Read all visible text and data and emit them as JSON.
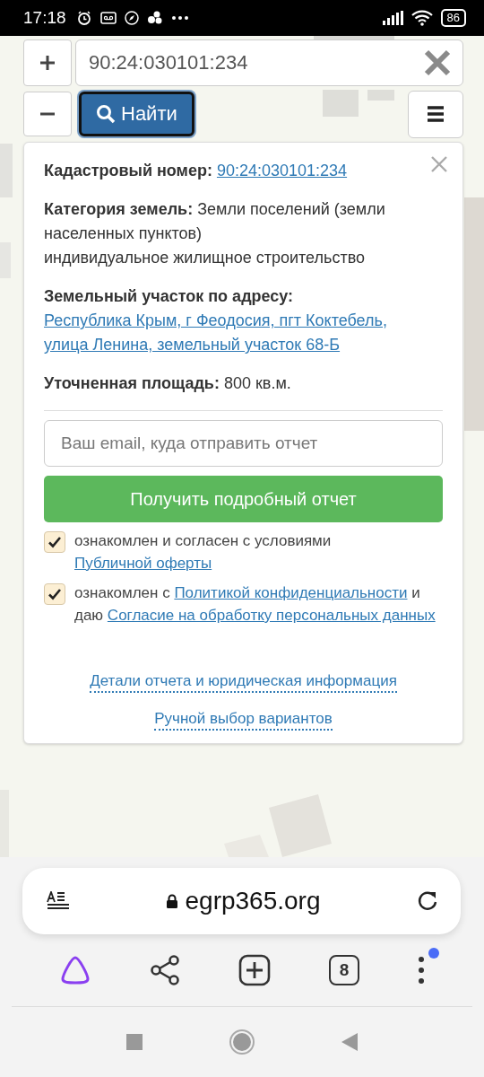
{
  "status_bar": {
    "time": "17:18",
    "battery": "86"
  },
  "search": {
    "value": "90:24:030101:234",
    "button": "Найти"
  },
  "info_card": {
    "fields": [
      {
        "kind": "link",
        "label": "Кадастровый номер:",
        "value": "90:24:030101:234"
      },
      {
        "kind": "text",
        "label": "Категория земель:",
        "value": "Земли поселений (земли населенных пунктов)",
        "note": "индивидуальное жилищное строительство"
      },
      {
        "kind": "link",
        "label": "Земельный участок по адресу:",
        "value": "Республика Крым, г Феодосия, пгт Коктебель, улица Ленина, земельный участок 68-Б"
      },
      {
        "kind": "text",
        "label": "Уточненная площадь:",
        "value": "800 кв.м."
      }
    ],
    "email": {
      "placeholder": "Ваш email, куда отправить отчет"
    },
    "submit": "Получить подробный отчет",
    "agreements": [
      {
        "checked": true,
        "parts": [
          {
            "kind": "text",
            "text": "ознакомлен и согласен с условиями "
          },
          {
            "kind": "link",
            "text": "Публичной оферты"
          }
        ]
      },
      {
        "checked": true,
        "parts": [
          {
            "kind": "text",
            "text": "ознакомлен с "
          },
          {
            "kind": "link",
            "text": "Политикой конфиденциальности"
          },
          {
            "kind": "text",
            "text": " и даю "
          },
          {
            "kind": "link",
            "text": "Согласие на обработку персональных данных"
          }
        ]
      }
    ],
    "links": [
      "Детали отчета и юридическая информация",
      "Ручной выбор вариантов"
    ]
  },
  "browser": {
    "address": "egrp365.org",
    "tab_count": "8",
    "menu_badge": true
  }
}
